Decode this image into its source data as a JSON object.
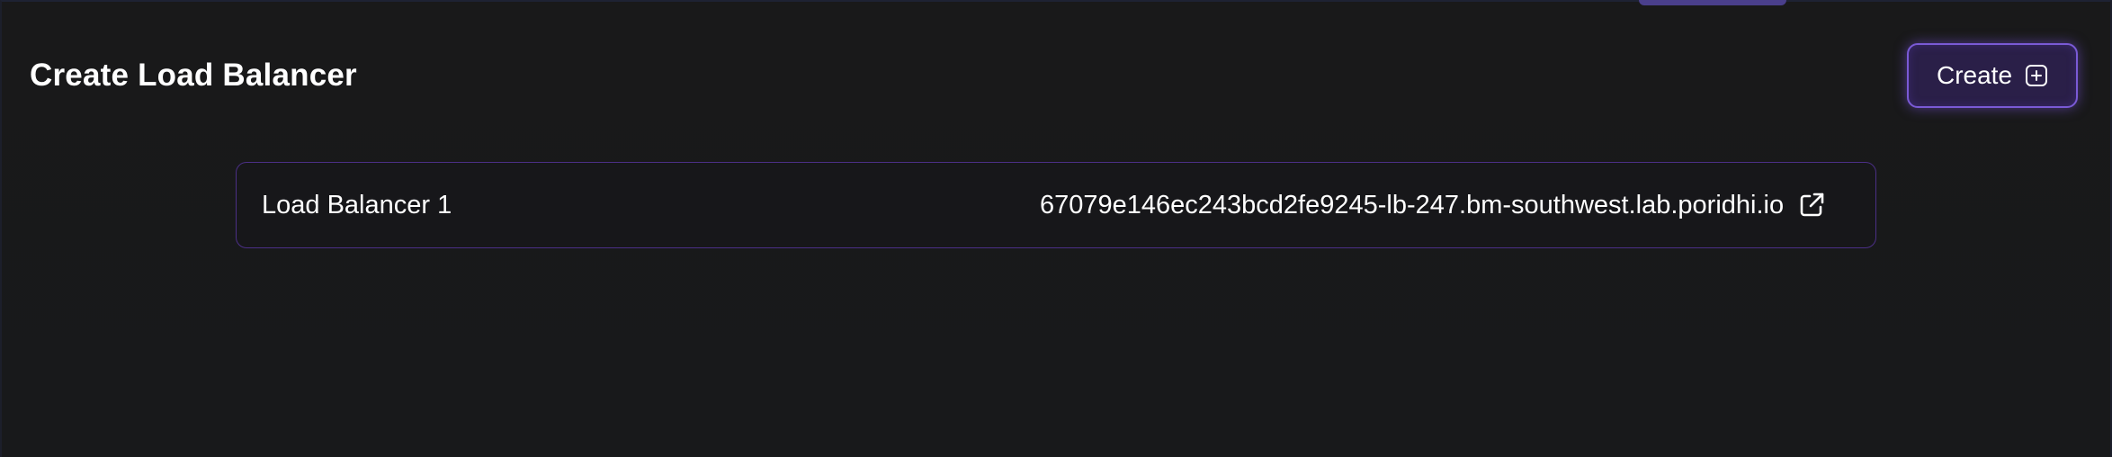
{
  "header": {
    "title": "Create Load Balancer",
    "create_label": "Create"
  },
  "load_balancers": [
    {
      "name": "Load Balancer 1",
      "host": "67079e146ec243bcd2fe9245-lb-247.bm-southwest.lab.poridhi.io"
    }
  ],
  "icons": {
    "create": "plus-square-icon",
    "open_link": "external-link-icon"
  },
  "colors": {
    "background": "#18181a",
    "accent": "#7a5ad6",
    "row_border": "#4b2f86"
  }
}
